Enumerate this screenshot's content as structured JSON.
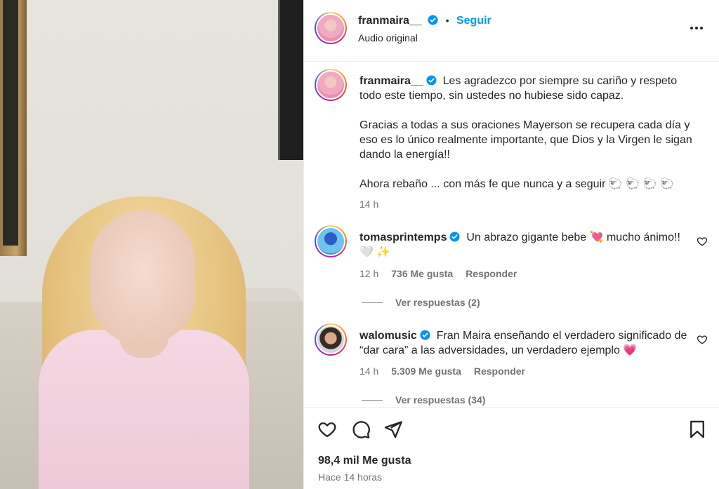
{
  "post": {
    "author": "franmaira__",
    "follow_label": "Seguir",
    "separator": "•",
    "audio": "Audio original"
  },
  "caption": {
    "author": "franmaira__",
    "para1": "Les agradezco por siempre su cariño y respeto todo este tiempo, sin ustedes no hubiese sido capaz.",
    "para2": "Gracias a todas a sus oraciones Mayerson se recupera cada día y eso es lo único realmente importante, que Dios y la Virgen le sigan dando la energía!!",
    "para3": "Ahora rebaño ... con más fe que nunca y a seguir 🐑 🐑 🐑 🐑",
    "time": "14 h"
  },
  "comments": [
    {
      "author": "tomasprintemps",
      "text": "Un abrazo gigante bebe 💘 mucho ánimo!! 🤍 ✨",
      "time": "12 h",
      "likes": "736 Me gusta",
      "reply_label": "Responder",
      "view_replies": "Ver respuestas (2)"
    },
    {
      "author": "walomusic",
      "text": "Fran Maira enseñando el verdadero significado de “dar cara” a las adversidades, un verdadero ejemplo 💗",
      "time": "14 h",
      "likes": "5.309 Me gusta",
      "reply_label": "Responder",
      "view_replies": "Ver respuestas (34)"
    }
  ],
  "footer": {
    "likes": "98,4 mil Me gusta",
    "time": "Hace 14 horas"
  },
  "icons": {
    "verified": "verified-badge-icon",
    "more": "more-options-icon",
    "like": "heart-icon",
    "comment": "comment-icon",
    "share": "share-icon",
    "save": "bookmark-icon"
  },
  "colors": {
    "accent": "#0095f6",
    "text": "#262626",
    "muted": "#737373"
  }
}
